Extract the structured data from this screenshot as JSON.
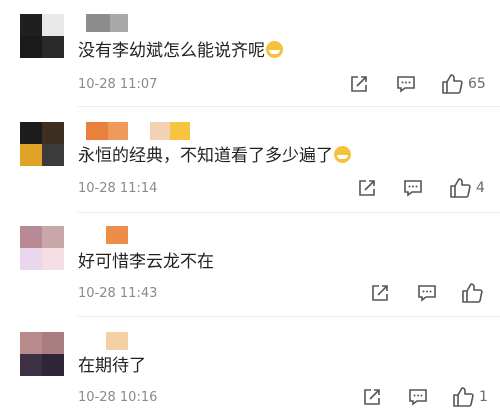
{
  "comments": [
    {
      "text": "没有李幼斌怎么能说齐呢",
      "has_emoji": true,
      "emoji_name": "laughing-tears-emoji",
      "time": "10-28 11:07",
      "likes": "65"
    },
    {
      "text": "永恒的经典，不知道看了多少遍了",
      "has_emoji": true,
      "emoji_name": "grinning-emoji",
      "time": "10-28 11:14",
      "likes": "4"
    },
    {
      "text": "好可惜李云龙不在",
      "has_emoji": false,
      "time": "10-28 11:43",
      "likes": ""
    },
    {
      "text": "在期待了",
      "has_emoji": false,
      "time": "10-28 10:16",
      "likes": "1"
    }
  ],
  "icons": {
    "share": "share-icon",
    "reply": "comment-icon",
    "like": "thumbs-up-icon"
  },
  "colors": {
    "text": "#222222",
    "meta": "#8a8a8a",
    "icon": "#555555",
    "emoji": "#f6c23e"
  }
}
